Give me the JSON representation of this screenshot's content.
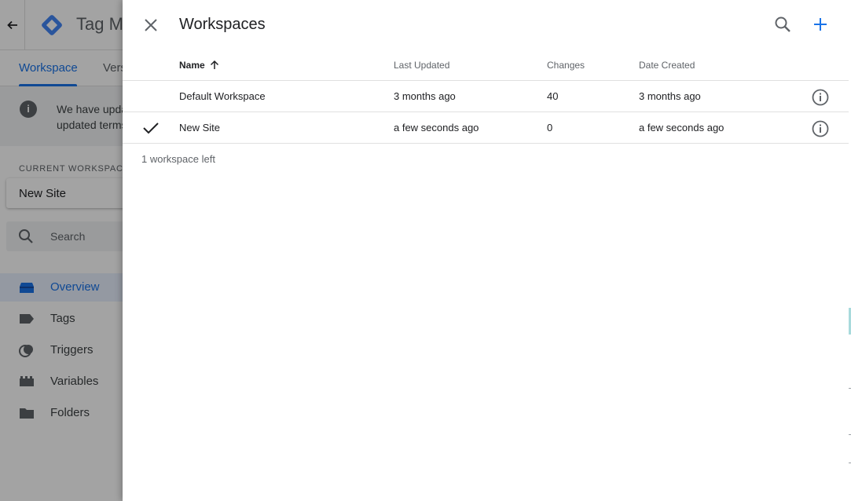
{
  "background": {
    "app_title": "Tag Ma",
    "tabs": [
      {
        "label": "Workspace",
        "active": true
      },
      {
        "label": "Vers",
        "active": false
      }
    ],
    "notice": {
      "line1": "We have upda",
      "line2": "updated terms"
    },
    "current_workspace_label": "CURRENT WORKSPACE",
    "current_workspace_name": "New Site",
    "search_placeholder": "Search",
    "nav": [
      {
        "label": "Overview",
        "icon": "overview-icon",
        "active": true
      },
      {
        "label": "Tags",
        "icon": "tag-icon",
        "active": false
      },
      {
        "label": "Triggers",
        "icon": "trigger-icon",
        "active": false
      },
      {
        "label": "Variables",
        "icon": "variables-icon",
        "active": false
      },
      {
        "label": "Folders",
        "icon": "folder-icon",
        "active": false
      }
    ]
  },
  "panel": {
    "title": "Workspaces",
    "columns": {
      "name": "Name",
      "last_updated": "Last Updated",
      "changes": "Changes",
      "date_created": "Date Created"
    },
    "rows": [
      {
        "selected": false,
        "name": "Default Workspace",
        "last_updated": "3 months ago",
        "changes": "40",
        "date_created": "3 months ago"
      },
      {
        "selected": true,
        "name": "New Site",
        "last_updated": "a few seconds ago",
        "changes": "0",
        "date_created": "a few seconds ago"
      }
    ],
    "footer_note": "1 workspace left"
  },
  "colors": {
    "accent": "#1a73e8",
    "text": "#202124",
    "muted": "#5f6368",
    "divider": "#e0e0e0"
  }
}
